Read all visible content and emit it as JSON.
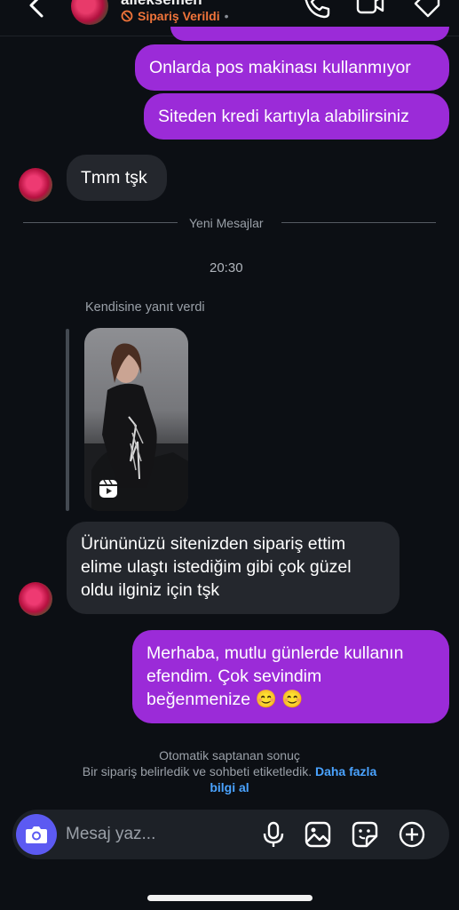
{
  "header": {
    "name": "alleksemen",
    "status": "Sipariş Verildi",
    "status_dot": "•"
  },
  "messages": {
    "out_1": "Onlarda pos makinası kullanmıyor",
    "out_2": "Siteden kredi kartıyla alabilirsiniz",
    "in_1": "Tmm tşk",
    "divider": "Yeni Mesajlar",
    "time": "20:30",
    "reply_label": "Kendisine yanıt verdi",
    "in_2_l1": "Ürününüzü sitenizden sipariş ettim",
    "in_2_l2": "elime ulaştı istediğim gibi çok güzel",
    "in_2_l3": "oldu ilginiz için tşk",
    "out_3_l1": "Merhaba, mutlu günlerde kullanın",
    "out_3_l2": "efendim. Çok sevindim",
    "out_3_l3": "beğenmenize 😊 😊"
  },
  "auto_notice": {
    "line1": "Otomatik saptanan sonuç",
    "line2": "Bir sipariş belirledik ve sohbeti etiketledik.",
    "link_a": "Daha fazla",
    "link_b": "bilgi al"
  },
  "composer": {
    "placeholder": "Mesaj yaz..."
  },
  "colors": {
    "outgoing_bubble": "#9b2bd8",
    "incoming_bubble": "#24272d",
    "status_orange": "#f0743a",
    "link_blue": "#4aa3ff",
    "camera_button": "#5c5af2"
  },
  "icons": [
    "back-chevron-icon",
    "phone-icon",
    "video-icon",
    "tag-icon",
    "camera-icon",
    "microphone-icon",
    "gallery-icon",
    "sticker-icon",
    "plus-circle-icon",
    "reel-icon"
  ]
}
